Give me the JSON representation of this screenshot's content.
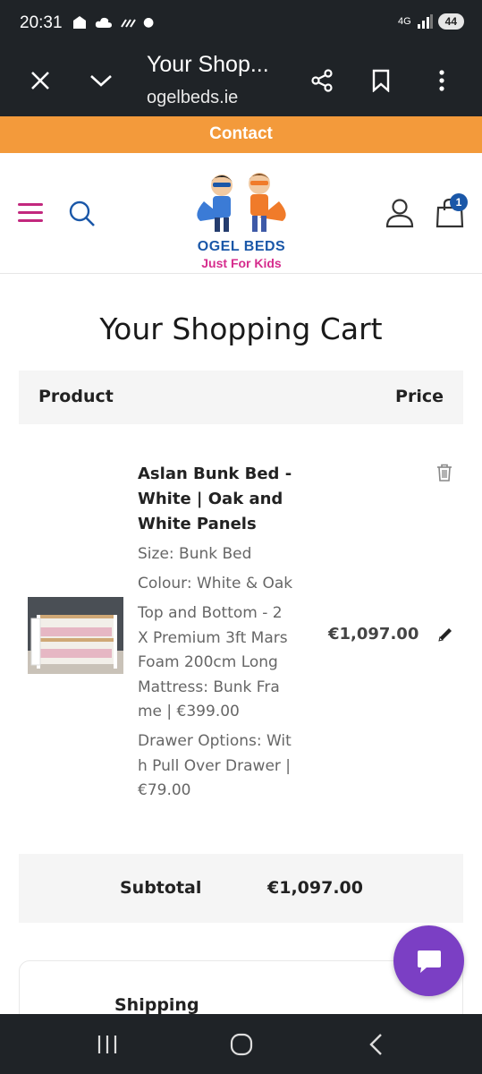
{
  "status_bar": {
    "time": "20:31",
    "network": "4G",
    "battery": "44"
  },
  "browser": {
    "title": "Your Shop...",
    "url": "ogelbeds.ie"
  },
  "contact_bar": {
    "label": "Contact"
  },
  "header": {
    "logo_line1": "OGEL BEDS",
    "logo_line2": "Just For Kids",
    "cart_count": "1"
  },
  "page": {
    "title": "Your Shopping Cart"
  },
  "table": {
    "col_product": "Product",
    "col_price": "Price"
  },
  "item": {
    "name": "Aslan Bunk Bed - White | Oak and White Panels",
    "name_lines": [
      "Aslan Bunk Bed -",
      "White | Oak and",
      "White Panels"
    ],
    "options": [
      {
        "lines": [
          "Size: Bunk Bed"
        ]
      },
      {
        "lines": [
          "Colour: White & Oak"
        ]
      },
      {
        "lines": [
          "Top and Bottom - 2",
          "X Premium 3ft Mars",
          "Foam 200cm Long",
          "Mattress: Bunk Fra",
          "me | €399.00"
        ]
      },
      {
        "lines": [
          "Drawer Options: Wit",
          "h Pull Over Drawer |",
          "€79.00"
        ]
      }
    ],
    "price": "€1,097.00"
  },
  "subtotal": {
    "label": "Subtotal",
    "value": "€1,097.00"
  },
  "shipping": {
    "label": "Shipping"
  },
  "colors": {
    "contact_bar": "#f39a3b",
    "brand_blue": "#1a57a8",
    "brand_pink": "#d62c8d",
    "chat_purple": "#7b3fc4"
  }
}
